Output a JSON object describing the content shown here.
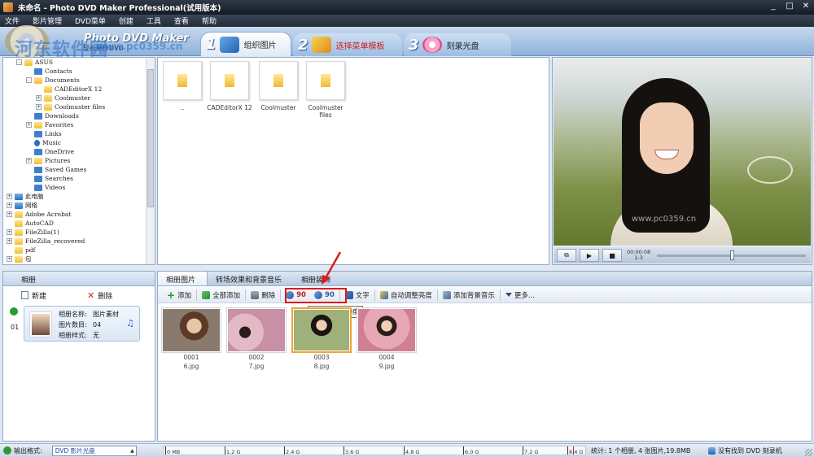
{
  "window": {
    "title": "未命名 - Photo DVD Maker Professional(试用版本)"
  },
  "menu": [
    "文件",
    "影片管理",
    "DVD菜单",
    "创建",
    "工具",
    "查看",
    "帮助"
  ],
  "header": {
    "brand": "Photo DVD Maker",
    "subtitle": "轻松制作DVD",
    "watermark": "河东软件园",
    "watermark_url": "www.pc0359.cn",
    "steps": [
      {
        "num": "1",
        "label": "组织图片"
      },
      {
        "num": "2",
        "label": "选择菜单模板"
      },
      {
        "num": "3",
        "label": "刻录光盘"
      }
    ]
  },
  "tree": [
    {
      "label": "ASUS",
      "indent": 1,
      "exp": "−",
      "icon": "folder"
    },
    {
      "label": "Contacts",
      "indent": 2,
      "exp": "",
      "icon": "blue"
    },
    {
      "label": "Documents",
      "indent": 2,
      "exp": "−",
      "icon": "folder"
    },
    {
      "label": "CADEditorX 12",
      "indent": 3,
      "exp": "",
      "icon": "folder"
    },
    {
      "label": "Coolmuster",
      "indent": 3,
      "exp": "+",
      "icon": "folder"
    },
    {
      "label": "Coolmuster files",
      "indent": 3,
      "exp": "+",
      "icon": "folder"
    },
    {
      "label": "Downloads",
      "indent": 2,
      "exp": "",
      "icon": "blue"
    },
    {
      "label": "Favorites",
      "indent": 2,
      "exp": "+",
      "icon": "folder"
    },
    {
      "label": "Links",
      "indent": 2,
      "exp": "",
      "icon": "blue"
    },
    {
      "label": "Music",
      "indent": 2,
      "exp": "",
      "icon": "music"
    },
    {
      "label": "OneDrive",
      "indent": 2,
      "exp": "",
      "icon": "blue"
    },
    {
      "label": "Pictures",
      "indent": 2,
      "exp": "+",
      "icon": "folder"
    },
    {
      "label": "Saved Games",
      "indent": 2,
      "exp": "",
      "icon": "blue"
    },
    {
      "label": "Searches",
      "indent": 2,
      "exp": "",
      "icon": "blue"
    },
    {
      "label": "Videos",
      "indent": 2,
      "exp": "",
      "icon": "blue"
    },
    {
      "label": "此电脑",
      "indent": 0,
      "exp": "+",
      "icon": "pc"
    },
    {
      "label": "网络",
      "indent": 0,
      "exp": "+",
      "icon": "pc"
    },
    {
      "label": "Adobe Acrobat",
      "indent": 0,
      "exp": "+",
      "icon": "folder"
    },
    {
      "label": "AutoCAD",
      "indent": 0,
      "exp": "",
      "icon": "folder"
    },
    {
      "label": "FileZilla(1)",
      "indent": 0,
      "exp": "+",
      "icon": "folder"
    },
    {
      "label": "FileZilla_recovered",
      "indent": 0,
      "exp": "+",
      "icon": "folder"
    },
    {
      "label": "pdf",
      "indent": 0,
      "exp": "",
      "icon": "folder"
    },
    {
      "label": "包",
      "indent": 0,
      "exp": "+",
      "icon": "folder"
    }
  ],
  "files": [
    "..",
    "CADEditorX 12",
    "Coolmuster",
    "Coolmuster files"
  ],
  "preview": {
    "watermark": "www.pc0359.cn",
    "time": "00:00:08",
    "time2": "1-3"
  },
  "album": {
    "tab": "相册",
    "new_label": "新建",
    "delete_label": "删除",
    "index": "01",
    "name_label": "相册名称:",
    "name_value": "图片素材",
    "count_label": "图片数目:",
    "count_value": "04",
    "style_label": "相册样式:",
    "style_value": "无"
  },
  "photo_tabs": [
    "相册图片",
    "转场效果和背景音乐",
    "相册装饰"
  ],
  "toolbar": {
    "add": "添加",
    "add_all": "全部添加",
    "delete": "删除",
    "rotate_ccw": "90",
    "rotate_cw": "90",
    "text": "文字",
    "auto_adjust": "自动调整亮度",
    "add_music": "添加背景音乐",
    "more": "更多..."
  },
  "tooltip": "逆时针旋转90度",
  "photos": [
    {
      "num": "0001",
      "file": "6.jpg"
    },
    {
      "num": "0002",
      "file": "7.jpg"
    },
    {
      "num": "0003",
      "file": "8.jpg"
    },
    {
      "num": "0004",
      "file": "9.jpg"
    }
  ],
  "status": {
    "output_label": "输出格式:",
    "output_value": "DVD 影片光盘",
    "capacity_ticks": [
      "0 MB",
      "1.2 G",
      "2.4 G",
      "3.6 G",
      "4.8 G",
      "6.0 G",
      "7.2 G",
      "8.4 G"
    ],
    "stats": "统计: 1 个相册, 4 张图片,19.8MB",
    "burner": "没有找到 DVD 刻录机"
  }
}
